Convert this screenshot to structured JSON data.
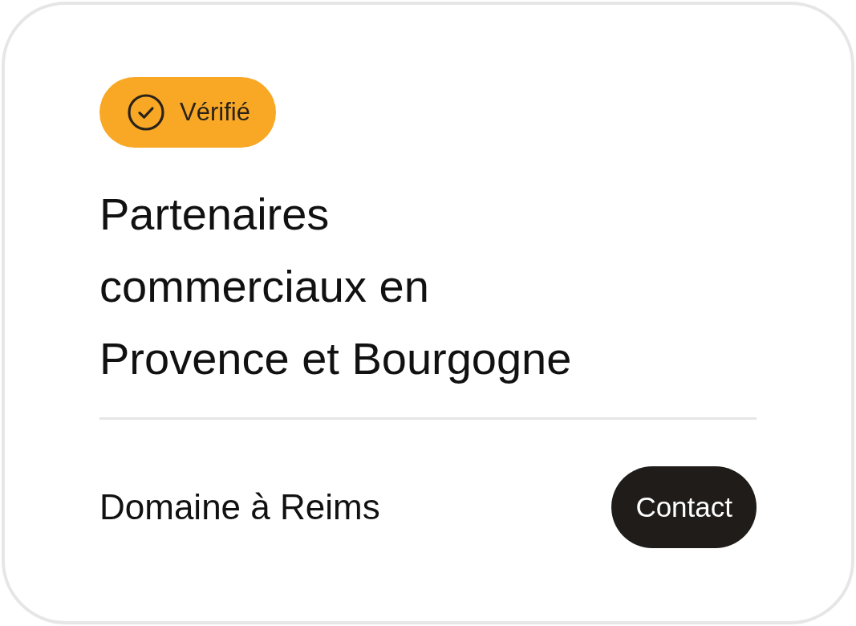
{
  "badge": {
    "label": "Vérifié"
  },
  "title_lines": [
    "Partenaires",
    "commerciaux en",
    "Provence et Bourgogne"
  ],
  "footer": {
    "location": "Domaine à Reims",
    "button": "Contact"
  }
}
